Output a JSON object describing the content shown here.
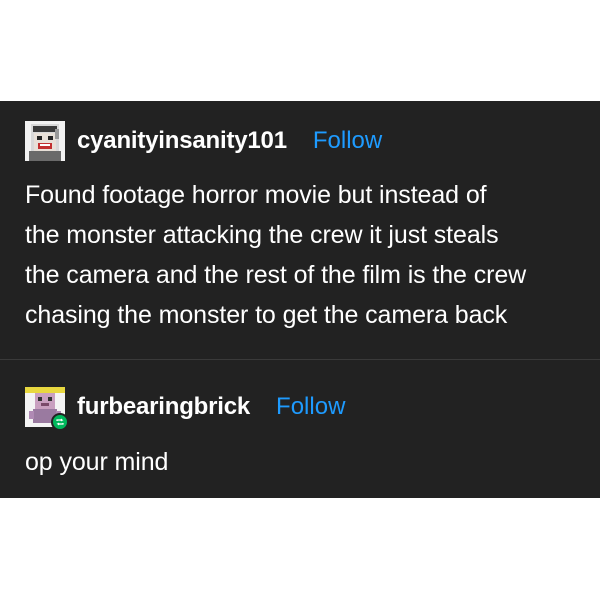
{
  "posts": [
    {
      "username": "cyanityinsanity101",
      "follow_label": "Follow",
      "avatar_icon": "pixel-avatar-face-icon",
      "lines": [
        "Found footage horror movie but instead of",
        "the monster attacking the crew it just steals",
        "the camera and the rest of the film is the crew",
        "chasing the monster to get the camera back"
      ]
    },
    {
      "username": "furbearingbrick",
      "follow_label": "Follow",
      "avatar_icon": "pixel-avatar-character-icon",
      "badge_icon": "reblog-icon",
      "lines": [
        "op your mind"
      ]
    }
  ],
  "colors": {
    "background": "#222222",
    "text": "#ffffff",
    "follow": "#1e9bff",
    "reblog_badge": "#00b85c"
  }
}
